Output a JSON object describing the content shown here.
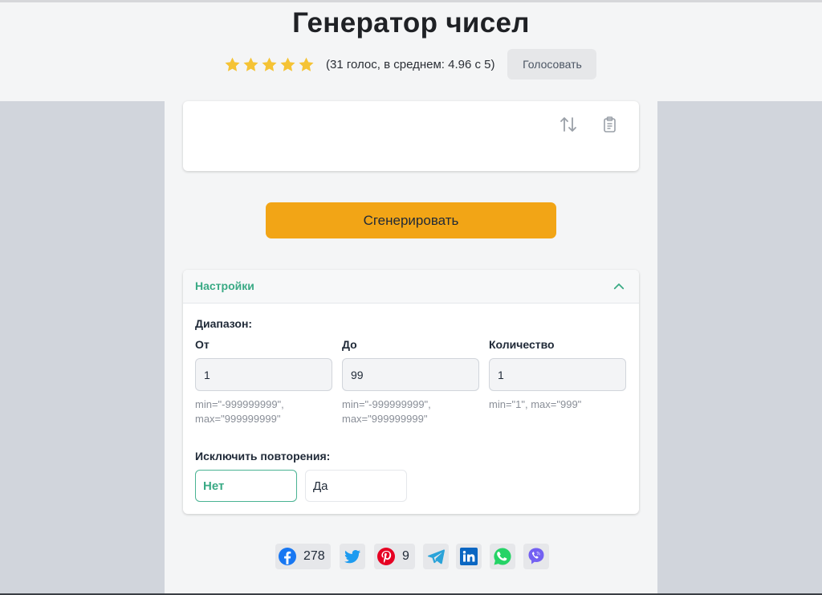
{
  "header": {
    "title": "Генератор чисел",
    "rating_text": "(31 голос, в среднем: 4.96 с 5)",
    "vote_label": "Голосовать",
    "stars": 5
  },
  "generate_label": "Сгенерировать",
  "settings": {
    "title": "Настройки",
    "range_label": "Диапазон:",
    "from": {
      "label": "От",
      "value": "1",
      "hint": "min=\"-999999999\", max=\"999999999\""
    },
    "to": {
      "label": "До",
      "value": "99",
      "hint": "min=\"-999999999\", max=\"999999999\""
    },
    "count": {
      "label": "Количество",
      "value": "1",
      "hint": "min=\"1\", max=\"999\""
    },
    "exclude_label": "Исключить повторения:",
    "no_label": "Нет",
    "yes_label": "Да",
    "selected": "Нет"
  },
  "share": {
    "facebook_count": "278",
    "pinterest_count": "9"
  },
  "colors": {
    "accent_green": "#3aaa85",
    "generate_orange": "#f2a516",
    "star_yellow": "#f5c335",
    "facebook": "#1877f2",
    "twitter": "#1d9bf0",
    "pinterest": "#e60023",
    "telegram": "#2aa3d9",
    "linkedin": "#0a66c2",
    "whatsapp": "#25d366",
    "viber": "#7360f2"
  },
  "icons": [
    "star-icon",
    "swap-icon",
    "clipboard-icon",
    "chevron-up-icon",
    "facebook-icon",
    "twitter-icon",
    "pinterest-icon",
    "telegram-icon",
    "linkedin-icon",
    "whatsapp-icon",
    "viber-icon"
  ]
}
